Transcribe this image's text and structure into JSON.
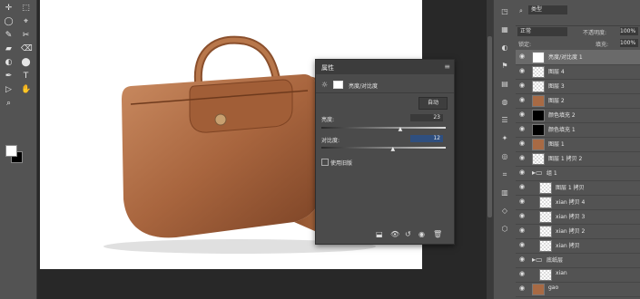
{
  "tools": [
    "✛",
    "⬚",
    "◯",
    "⌖",
    "✎",
    "✂",
    "▰",
    "⌫",
    "◐",
    "⬤",
    "✒",
    "T",
    "▷",
    "✋",
    "⌕"
  ],
  "canvas": {
    "description_free": true
  },
  "properties": {
    "tab_label": "属性",
    "adjustment_title": "亮度/对比度",
    "auto_button": "自动",
    "brightness_label": "亮度:",
    "brightness_value": "23",
    "contrast_label": "对比度:",
    "contrast_value": "12",
    "legacy_label": "使用旧版",
    "brightness_fraction": 0.64,
    "contrast_fraction": 0.58
  },
  "layers_panel": {
    "filter_label": "类型",
    "blend_mode": "正常",
    "opacity_label": "不透明度:",
    "opacity_value": "100%",
    "lock_label": "锁定:",
    "fill_label": "填充:",
    "fill_value": "100%",
    "layers": [
      {
        "name": "亮度/对比度 1",
        "thumb": "white",
        "indent": 0
      },
      {
        "name": "图层 4",
        "thumb": "checker",
        "indent": 0
      },
      {
        "name": "图层 3",
        "thumb": "checker",
        "indent": 0
      },
      {
        "name": "图层 2",
        "thumb": "bag",
        "indent": 0
      },
      {
        "name": "颜色填充 2",
        "thumb": "black",
        "indent": 0
      },
      {
        "name": "颜色填充 1",
        "thumb": "black",
        "indent": 0
      },
      {
        "name": "图层 1",
        "thumb": "bag",
        "indent": 0
      },
      {
        "name": "图层 1 拷贝 2",
        "thumb": "checker",
        "indent": 0
      },
      {
        "name": "组 1",
        "thumb": "folder",
        "indent": 0
      },
      {
        "name": "图层 1 拷贝",
        "thumb": "checker",
        "indent": 1
      },
      {
        "name": "xian 拷贝 4",
        "thumb": "checker",
        "indent": 1
      },
      {
        "name": "xian 拷贝 3",
        "thumb": "checker",
        "indent": 1
      },
      {
        "name": "xian 拷贝 2",
        "thumb": "checker",
        "indent": 1
      },
      {
        "name": "xian 拷贝",
        "thumb": "checker",
        "indent": 1
      },
      {
        "name": "底纸层",
        "thumb": "folder",
        "indent": 0
      },
      {
        "name": "xian",
        "thumb": "checker",
        "indent": 1
      },
      {
        "name": "gao",
        "thumb": "bag",
        "indent": 0
      }
    ]
  },
  "colors": {
    "foreground": "#ffffff",
    "background": "#000000",
    "bag": "#a86a44"
  }
}
